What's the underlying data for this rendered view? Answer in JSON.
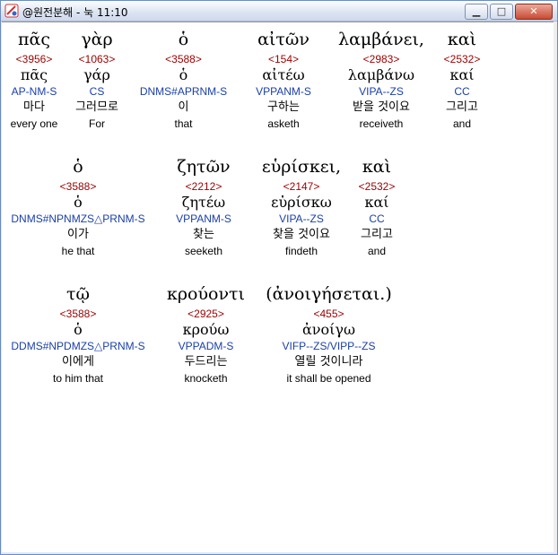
{
  "window": {
    "title": "@원전분해 - 눅 11:10",
    "minimize_label": "▁",
    "maximize_label": "□",
    "close_label": "✕"
  },
  "verse_rows": [
    {
      "words": [
        {
          "greek": "πᾶς",
          "strong": "<3956>",
          "lemma": "πᾶς",
          "parse": "AP-NM-S",
          "korean": "마다",
          "english": "every one"
        },
        {
          "greek": "γὰρ",
          "strong": "<1063>",
          "lemma": "γάρ",
          "parse": "CS",
          "korean": "그러므로",
          "english": "For"
        },
        {
          "greek": "ὁ",
          "strong": "<3588>",
          "lemma": "ὁ",
          "parse": "DNMS#APRNM-S",
          "korean": "이",
          "english": "that"
        },
        {
          "greek": "αἰτῶν",
          "strong": "<154>",
          "lemma": "αἰτέω",
          "parse": "VPPANM-S",
          "korean": "구하는",
          "english": "asketh"
        },
        {
          "greek": "λαμβάνει,",
          "strong": "<2983>",
          "lemma": "λαμβάνω",
          "parse": "VIPA--ZS",
          "korean": "받을 것이요",
          "english": "receiveth"
        },
        {
          "greek": "καὶ",
          "strong": "<2532>",
          "lemma": "καί",
          "parse": "CC",
          "korean": "그리고",
          "english": "and"
        }
      ]
    },
    {
      "words": [
        {
          "greek": "ὁ",
          "strong": "<3588>",
          "lemma": "ὁ",
          "parse": "DNMS#NPNMZS△PRNM-S",
          "korean": "이가",
          "english": "he that"
        },
        {
          "greek": "ζητῶν",
          "strong": "<2212>",
          "lemma": "ζητέω",
          "parse": "VPPANM-S",
          "korean": "찾는",
          "english": "seeketh"
        },
        {
          "greek": "εὑρίσκει,",
          "strong": "<2147>",
          "lemma": "εὑρίσκω",
          "parse": "VIPA--ZS",
          "korean": "찾을 것이요",
          "english": "findeth"
        },
        {
          "greek": "καὶ",
          "strong": "<2532>",
          "lemma": "καί",
          "parse": "CC",
          "korean": "그리고",
          "english": "and"
        }
      ]
    },
    {
      "words": [
        {
          "greek": "τῷ",
          "strong": "<3588>",
          "lemma": "ὁ",
          "parse": "DDMS#NPDMZS△PRNM-S",
          "korean": "이에게",
          "english": "to him that"
        },
        {
          "greek": "κρούοντι",
          "strong": "<2925>",
          "lemma": "κρούω",
          "parse": "VPPADM-S",
          "korean": "두드리는",
          "english": "knocketh"
        },
        {
          "greek": "(ἀνοιγήσεται.)",
          "strong": "<455>",
          "lemma": "ἀνοίγω",
          "parse": "VIFP--ZS/VIPP--ZS",
          "korean": "열릴 것이니라",
          "english": "it shall be opened"
        }
      ]
    }
  ],
  "colors": {
    "strong": "#990000",
    "parse": "#1a3fa8",
    "selection_bg": "#ffffff",
    "row_bg": "#ecebe9"
  },
  "icons": [
    "app-icon",
    "minimize-icon",
    "maximize-icon",
    "close-icon"
  ]
}
